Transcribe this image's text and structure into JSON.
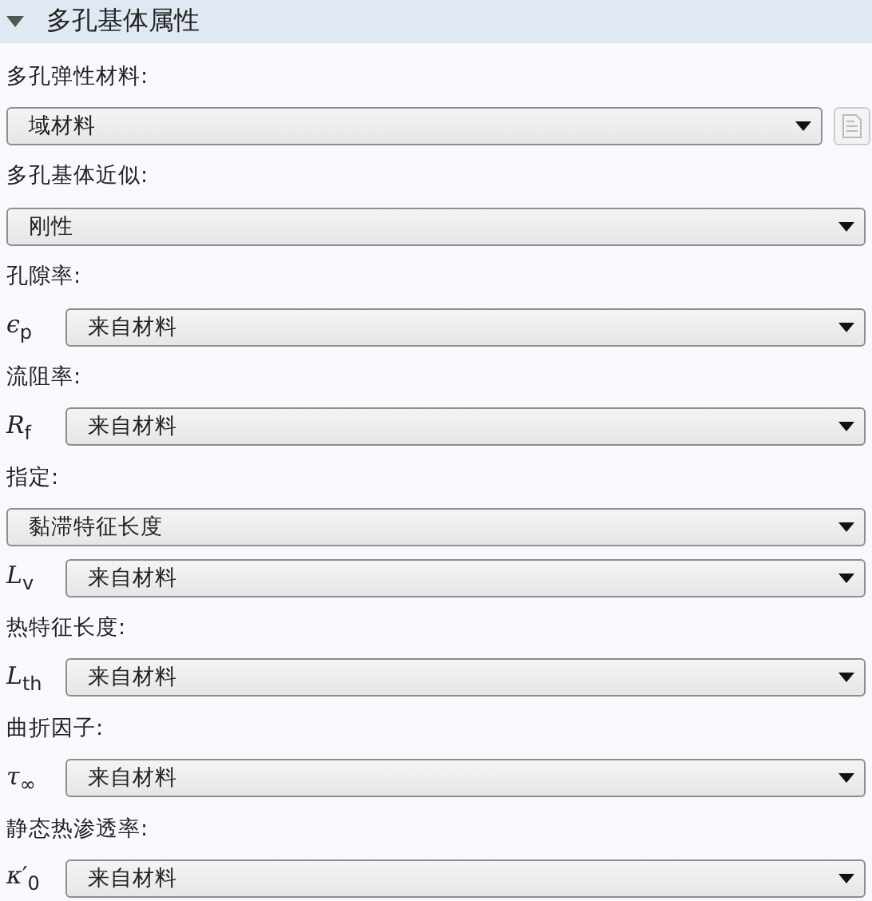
{
  "section": {
    "title": "多孔基体属性",
    "expanded": true
  },
  "rows": [
    {
      "kind": "label",
      "text": "多孔弹性材料:"
    },
    {
      "kind": "select_button",
      "value": "域材料",
      "button_disabled": true
    },
    {
      "kind": "label",
      "text": "多孔基体近似:"
    },
    {
      "kind": "select",
      "value": "刚性"
    },
    {
      "kind": "label",
      "text": "孔隙率:"
    },
    {
      "kind": "symbol_select",
      "symbol": "*ϵ*$_{p}$",
      "value": "来自材料"
    },
    {
      "kind": "label",
      "text": "流阻率:"
    },
    {
      "kind": "symbol_select",
      "symbol": "*R*$_{f}$",
      "value": "来自材料"
    },
    {
      "kind": "label",
      "text": "指定:"
    },
    {
      "kind": "select",
      "value": "黏滞特征长度"
    },
    {
      "kind": "symbol_select",
      "symbol": "*L*$_{v}$",
      "value": "来自材料"
    },
    {
      "kind": "label",
      "text": "热特征长度:"
    },
    {
      "kind": "symbol_select",
      "symbol": "*L*$_{th}$",
      "value": "来自材料"
    },
    {
      "kind": "label",
      "text": "曲折因子:"
    },
    {
      "kind": "symbol_select",
      "symbol": "*τ*$_{∞}$",
      "value": "来自材料"
    },
    {
      "kind": "label",
      "text": "静态热渗透率:"
    },
    {
      "kind": "symbol_select",
      "symbol": "*κ*′$_{0}$",
      "value": "来自材料"
    }
  ]
}
